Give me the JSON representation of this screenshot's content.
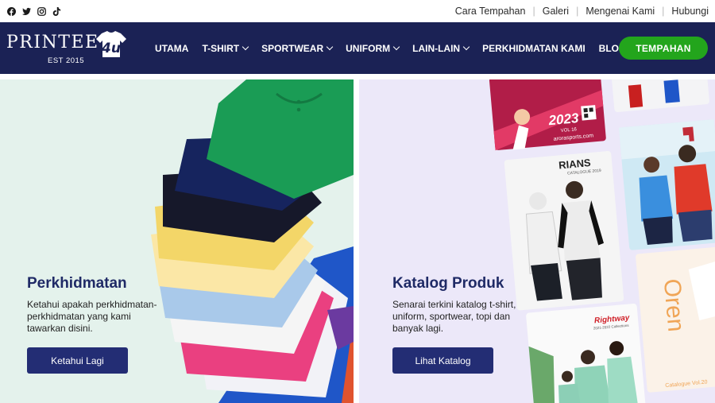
{
  "social": {
    "icons": [
      "facebook-icon",
      "twitter-icon",
      "instagram-icon",
      "tiktok-icon"
    ]
  },
  "toplinks": [
    "Cara Tempahan",
    "Galeri",
    "Mengenai Kami",
    "Hubungi"
  ],
  "logo": {
    "text": "PRINTEE",
    "badge": "4u",
    "est": "EST 2015"
  },
  "menu": [
    {
      "label": "UTAMA",
      "dropdown": false
    },
    {
      "label": "T-SHIRT",
      "dropdown": true
    },
    {
      "label": "SPORTWEAR",
      "dropdown": true
    },
    {
      "label": "UNIFORM",
      "dropdown": true
    },
    {
      "label": "LAIN-LAIN",
      "dropdown": true
    },
    {
      "label": "PERKHIDMATAN KAMI",
      "dropdown": false
    },
    {
      "label": "BLOG",
      "dropdown": false
    }
  ],
  "cta_label": "TEMPAHAN",
  "services": {
    "title": "Perkhidmatan",
    "desc_1": "Ketahui apakah perkhidmatan-",
    "desc_2": "perkhidmatan yang kami",
    "desc_3": "tawarkan disini.",
    "button": "Ketahui Lagi"
  },
  "catalog": {
    "title": "Katalog Produk",
    "desc_1": "Senarai terkini katalog t-shirt,",
    "desc_2": "uniform, sportwear, topi dan",
    "desc_3": "banyak lagi.",
    "button": "Lihat Katalog",
    "covers": {
      "arora_year": "2023",
      "arora_vol": "VOL 16",
      "arora_url": "arorasports.com",
      "rians": "RIANS",
      "rians_sub": "CATALOGUE 2019",
      "rightway": "Rightway",
      "rightway_sub": "2021-2022 Collections",
      "oren": "Oren",
      "oren_sub": "Catalogue Vol.20"
    }
  },
  "colors": {
    "nav_bg": "#1b2255",
    "cta": "#23a51c",
    "button": "#232d74",
    "left_panel": "#e4f2ec",
    "right_panel": "#ece8f9"
  }
}
